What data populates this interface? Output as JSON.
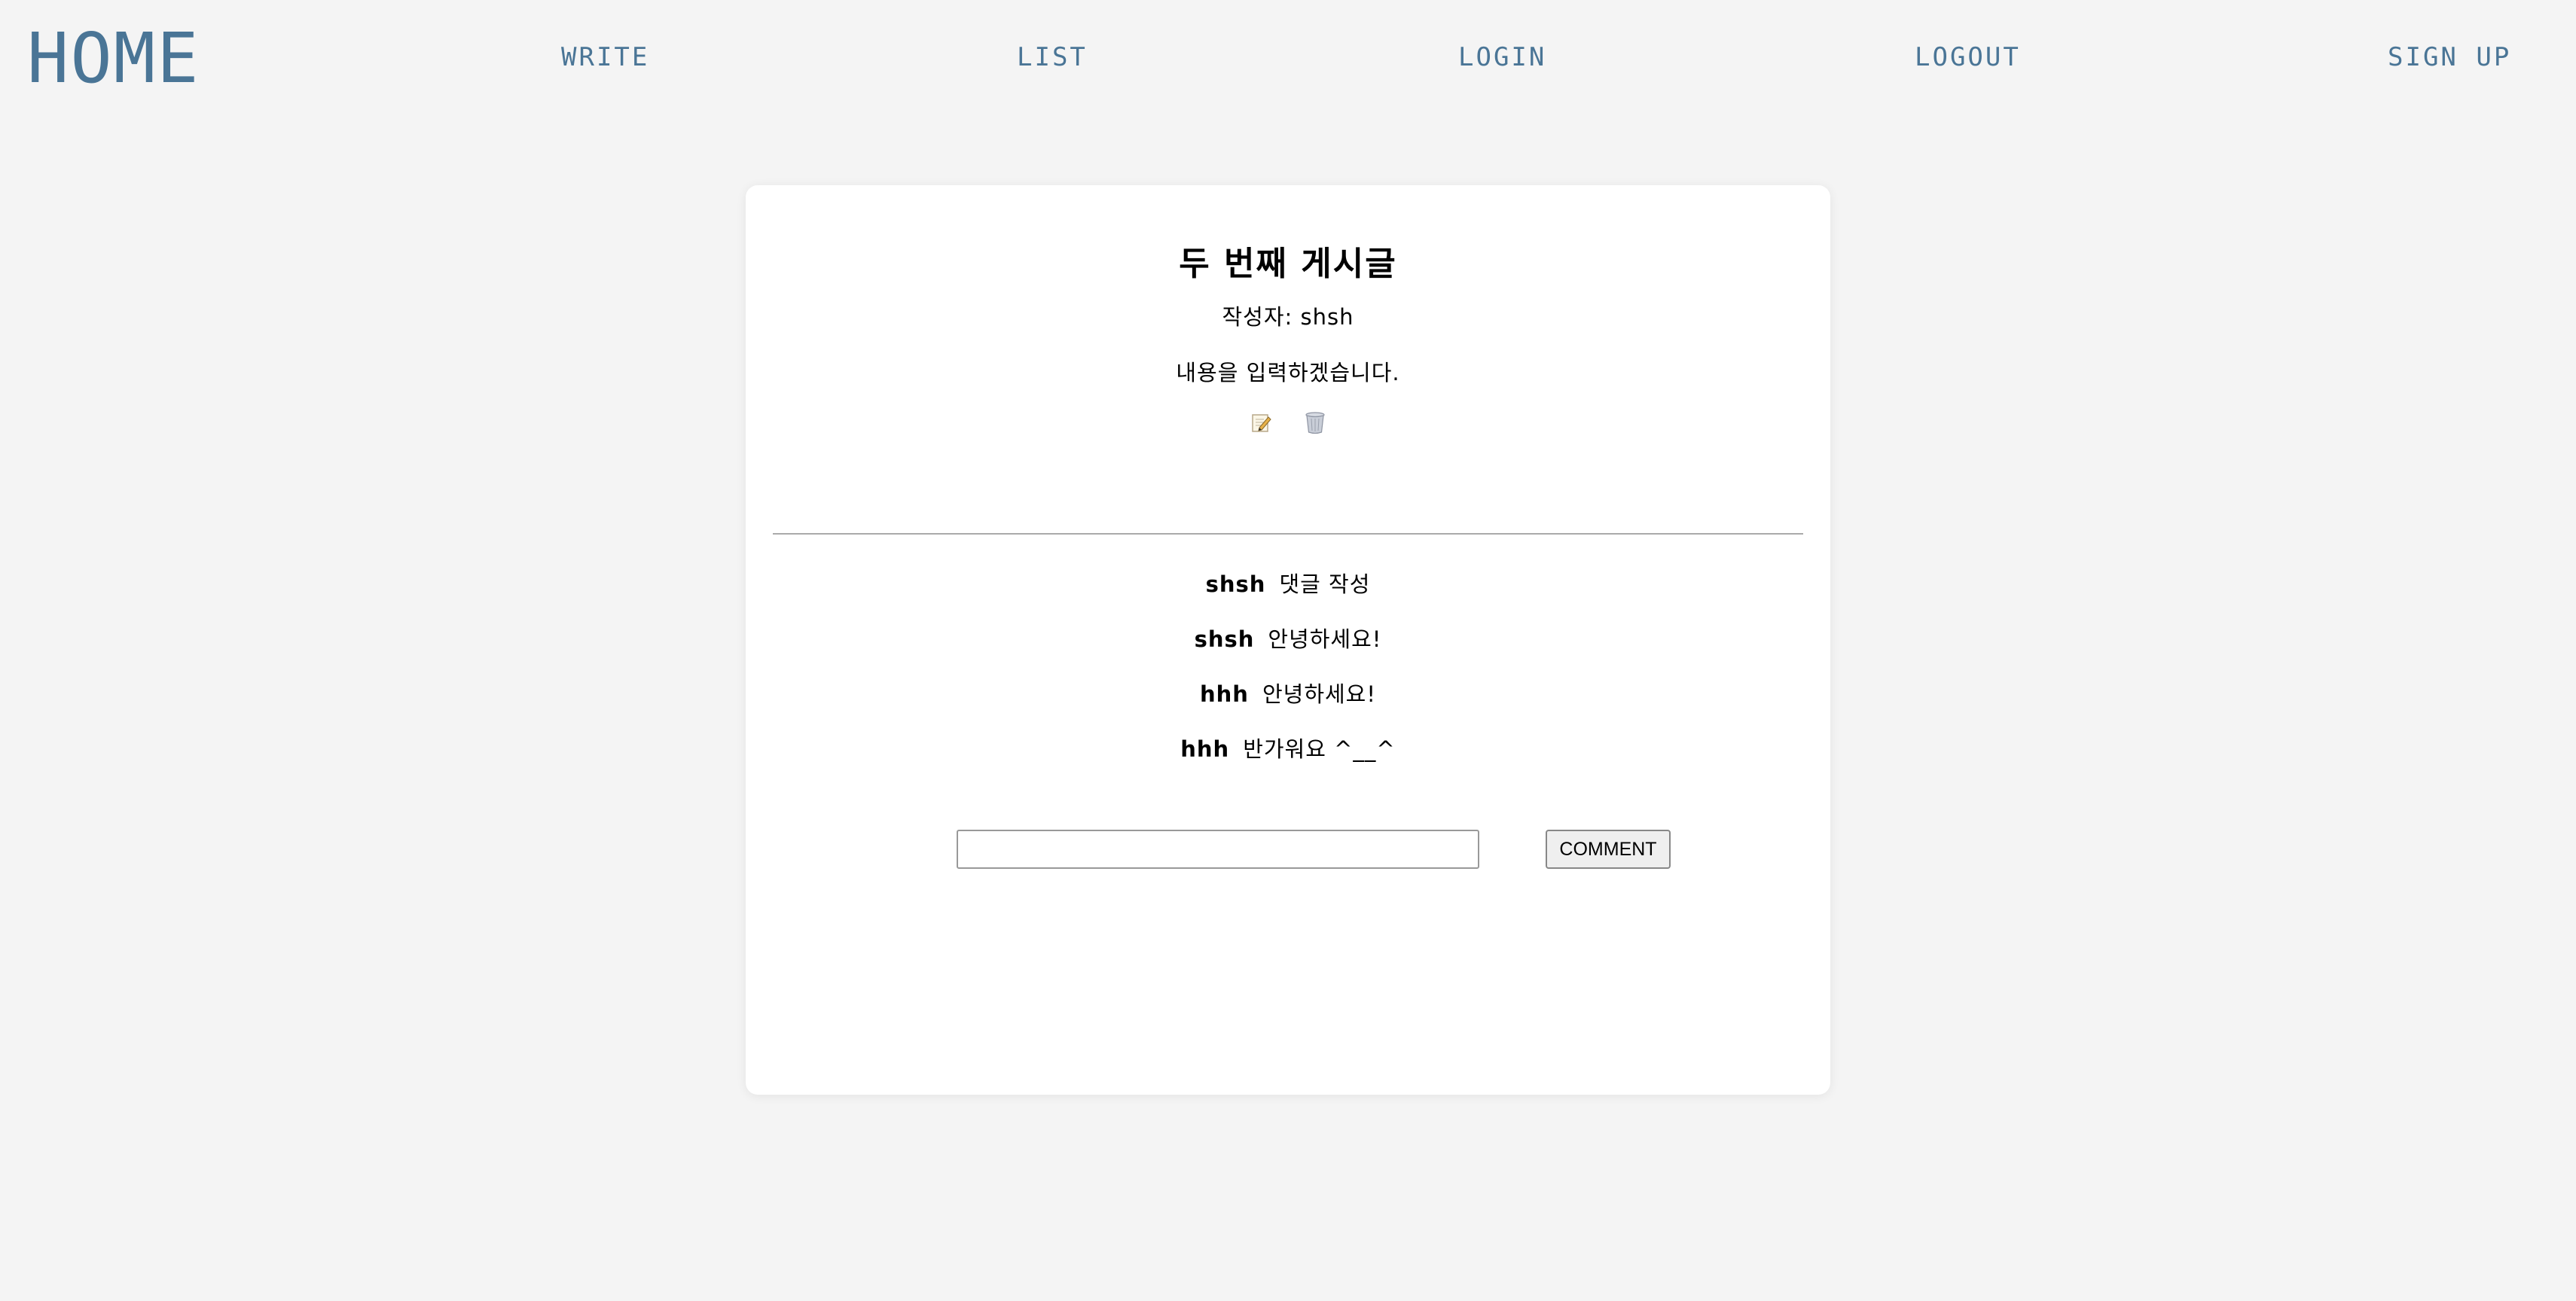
{
  "nav": {
    "home": "HOME",
    "write": "WRITE",
    "list": "LIST",
    "login": "LOGIN",
    "logout": "LOGOUT",
    "signup": "SIGN UP"
  },
  "post": {
    "title": "두 번째 게시글",
    "author": "작성자: shsh",
    "content": "내용을 입력하겠습니다.",
    "edit_icon": "memo-pencil-icon",
    "delete_icon": "trash-can-icon"
  },
  "comments": [
    {
      "author": "shsh",
      "text": "댓글 작성"
    },
    {
      "author": "shsh",
      "text": "안녕하세요!"
    },
    {
      "author": "hhh",
      "text": "안녕하세요!"
    },
    {
      "author": "hhh",
      "text": "반가워요 ^__^"
    }
  ],
  "comment_form": {
    "value": "",
    "button_label": "COMMENT"
  },
  "colors": {
    "nav_link": "#4a7596",
    "background": "#f4f4f4",
    "card": "#ffffff"
  }
}
